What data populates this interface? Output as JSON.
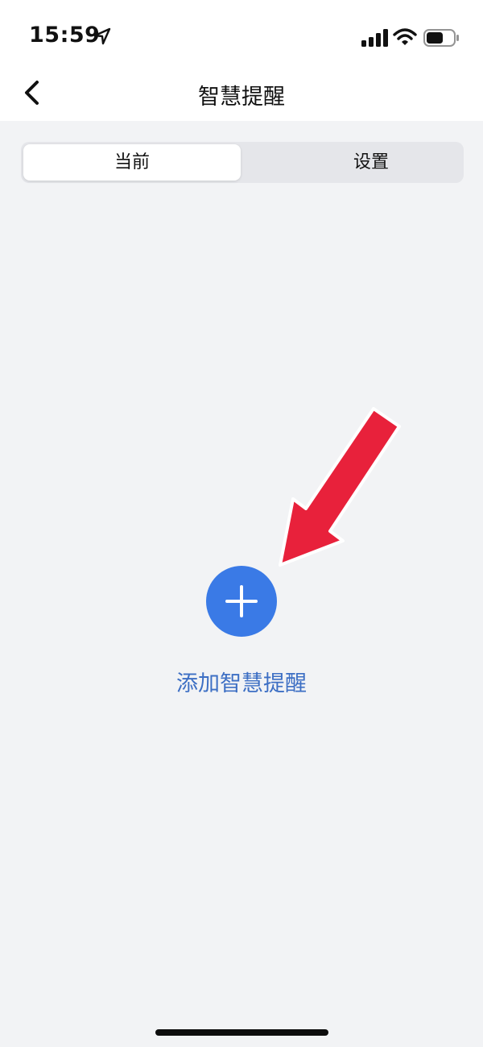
{
  "status_bar": {
    "time": "15:59",
    "icons": [
      "location-arrow-icon",
      "cellular-signal-icon",
      "wifi-icon",
      "battery-icon"
    ]
  },
  "nav": {
    "title": "智慧提醒",
    "back_icon": "chevron-left-icon"
  },
  "segment": {
    "tabs": [
      {
        "label": "当前",
        "selected": true
      },
      {
        "label": "设置",
        "selected": false
      }
    ]
  },
  "main": {
    "add_icon": "plus-icon",
    "add_label": "添加智慧提醒",
    "accent_color": "#3a7ae6",
    "label_color": "#3d6fc4"
  },
  "annotation": {
    "arrow_color": "#e8213b"
  }
}
